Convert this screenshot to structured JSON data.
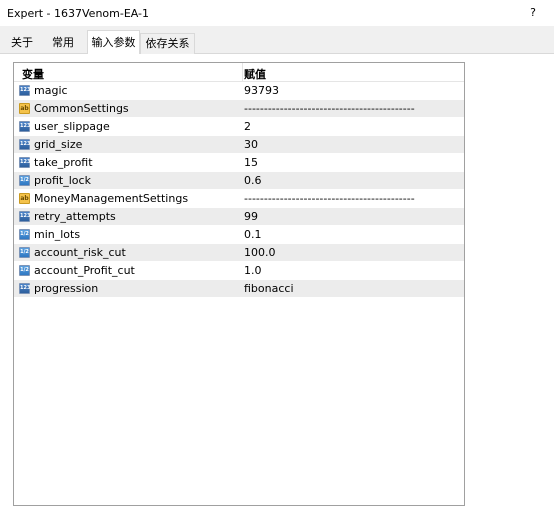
{
  "window": {
    "title": "Expert - 1637Venom-EA-1",
    "help_label": "?"
  },
  "tabs": [
    {
      "label": "关于"
    },
    {
      "label": "常用"
    },
    {
      "label": "输入参数",
      "active": true
    },
    {
      "label": "依存关系"
    }
  ],
  "table": {
    "columns": {
      "name": "变量",
      "value": "赋值"
    },
    "rows": [
      {
        "type": "int",
        "icon": "integer-icon",
        "name": "magic",
        "value": "93793"
      },
      {
        "type": "string",
        "icon": "string-icon",
        "name": "CommonSettings",
        "value": "-------------------------------------------"
      },
      {
        "type": "int",
        "icon": "integer-icon",
        "name": "user_slippage",
        "value": "2"
      },
      {
        "type": "int",
        "icon": "integer-icon",
        "name": "grid_size",
        "value": "30"
      },
      {
        "type": "int",
        "icon": "integer-icon",
        "name": "take_profit",
        "value": "15"
      },
      {
        "type": "double",
        "icon": "double-icon",
        "name": "profit_lock",
        "value": "0.6"
      },
      {
        "type": "string",
        "icon": "string-icon",
        "name": "MoneyManagementSettings",
        "value": "-------------------------------------------"
      },
      {
        "type": "int",
        "icon": "integer-icon",
        "name": "retry_attempts",
        "value": "99"
      },
      {
        "type": "double",
        "icon": "double-icon",
        "name": "min_lots",
        "value": "0.1"
      },
      {
        "type": "double",
        "icon": "double-icon",
        "name": "account_risk_cut",
        "value": "100.0"
      },
      {
        "type": "double",
        "icon": "double-icon",
        "name": "account_Profit_cut",
        "value": "1.0"
      },
      {
        "type": "int",
        "icon": "integer-icon",
        "name": "progression",
        "value": "fibonacci"
      }
    ]
  },
  "icon_glyphs": {
    "int": "123",
    "double": "1/2",
    "string": "ab"
  },
  "colors": {
    "alt_row": "#ececec",
    "int_icon": "#3a6fb3",
    "double_icon": "#2f78c2",
    "string_icon": "#f4c24a"
  }
}
